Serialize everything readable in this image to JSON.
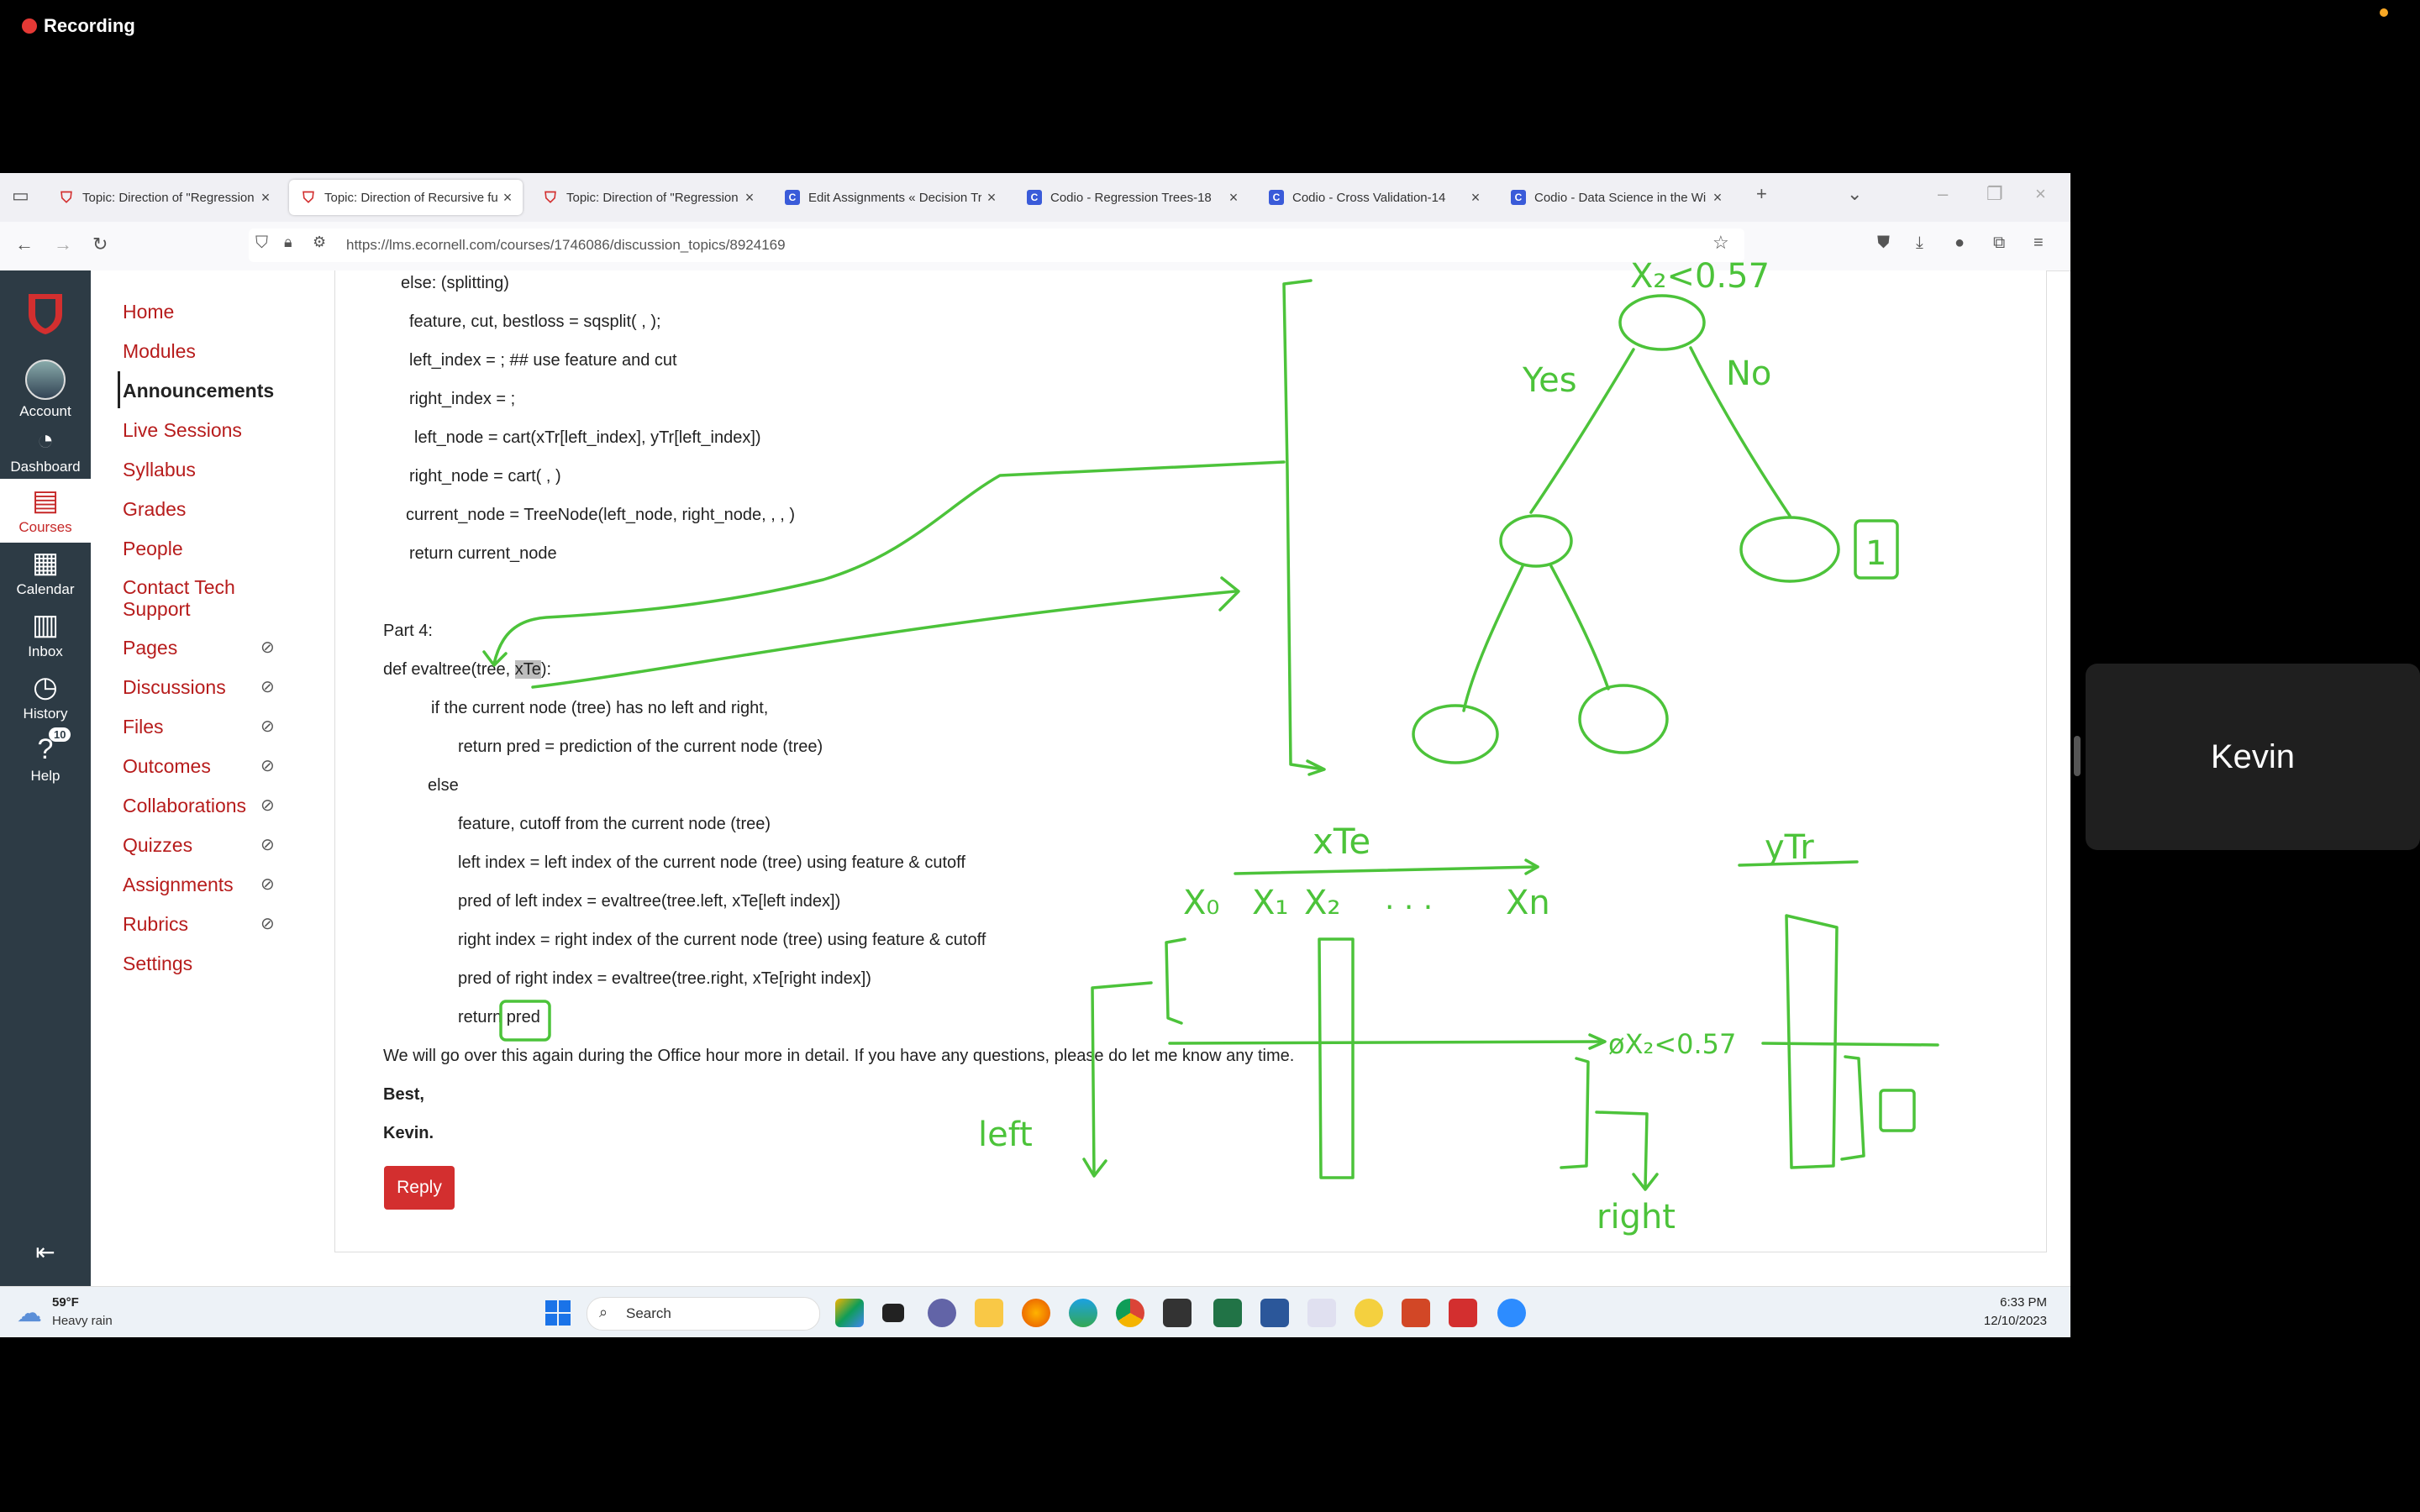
{
  "recording": {
    "label": "Recording"
  },
  "browser": {
    "tabs": [
      {
        "label": "Topic: Direction of \"Regression",
        "icon": "canvas",
        "active": false
      },
      {
        "label": "Topic: Direction of Recursive fu",
        "icon": "canvas",
        "active": true
      },
      {
        "label": "Topic: Direction of \"Regression",
        "icon": "canvas",
        "active": false
      },
      {
        "label": "Edit Assignments « Decision Tr",
        "icon": "codio",
        "active": false
      },
      {
        "label": "Codio - Regression Trees-18",
        "icon": "codio",
        "active": false
      },
      {
        "label": "Codio - Cross Validation-14",
        "icon": "codio",
        "active": false
      },
      {
        "label": "Codio - Data Science in the Wi",
        "icon": "codio",
        "active": false
      }
    ],
    "url": "https://lms.ecornell.com/courses/1746086/discussion_topics/8924169"
  },
  "global_nav": {
    "items": [
      {
        "label": "Account",
        "icon": "avatar-icon"
      },
      {
        "label": "Dashboard",
        "icon": "dashboard-icon"
      },
      {
        "label": "Courses",
        "icon": "courses-icon",
        "active": true
      },
      {
        "label": "Calendar",
        "icon": "calendar-icon"
      },
      {
        "label": "Inbox",
        "icon": "inbox-icon"
      },
      {
        "label": "History",
        "icon": "history-icon"
      },
      {
        "label": "Help",
        "icon": "help-icon",
        "badge": "10"
      }
    ],
    "collapse_icon": "collapse-icon"
  },
  "course_nav": {
    "items": [
      {
        "label": "Home"
      },
      {
        "label": "Modules"
      },
      {
        "label": "Announcements",
        "active": true
      },
      {
        "label": "Live Sessions"
      },
      {
        "label": "Syllabus"
      },
      {
        "label": "Grades"
      },
      {
        "label": "People"
      },
      {
        "label": "Contact Tech",
        "label2": "Support"
      },
      {
        "label": "Pages",
        "hidden": true
      },
      {
        "label": "Discussions",
        "hidden": true
      },
      {
        "label": "Files",
        "hidden": true
      },
      {
        "label": "Outcomes",
        "hidden": true
      },
      {
        "label": "Collaborations",
        "hidden": true
      },
      {
        "label": "Quizzes",
        "hidden": true
      },
      {
        "label": "Assignments",
        "hidden": true
      },
      {
        "label": "Rubrics",
        "hidden": true
      },
      {
        "label": "Settings"
      }
    ]
  },
  "post": {
    "lines": [
      "else: (splitting)",
      "feature, cut, bestloss = sqsplit(  , );",
      "left_index = ; ## use feature and cut",
      "right_index = ;",
      "left_node = cart(xTr[left_index], yTr[left_index])",
      "right_node = cart( , )",
      "current_node = TreeNode(left_node, right_node, , , )",
      "return current_node",
      "Part 4:",
      "def evaltree(tree, ",
      "xTe",
      "):",
      "if the current node (tree) has no left and right,",
      "return pred = prediction of the current node (tree)",
      "else",
      "feature, cutoff from the current node (tree)",
      "left index = left index of the current node (tree) using feature & cutoff",
      "pred of left index = evaltree(tree.left, xTe[left index])",
      "right index = right index of the current node (tree) using feature & cutoff",
      "pred of right index = evaltree(tree.right, xTe[right index])",
      "return pred",
      "We will go over this again during the Office hour more in detail.  If you have any questions, please do let me know any time.",
      "Best,",
      "Kevin."
    ],
    "reply_label": "Reply"
  },
  "annotations": {
    "split": "X₂<0.57",
    "yes": "Yes",
    "no": "No",
    "leaf": "1",
    "xte": "xTe",
    "ytr": "yTr",
    "x0": "X₀",
    "x1": "X₁",
    "x2": "X₂",
    "dots": ". . .",
    "xn": "Xn",
    "cond": "øX₂<0.57",
    "left": "left",
    "right": "right",
    "ink_color": "#4cc33a"
  },
  "taskbar": {
    "weather_temp": "59°F",
    "weather_desc": "Heavy rain",
    "search_placeholder": "Search",
    "time": "6:33 PM",
    "date": "12/10/2023"
  },
  "participant": {
    "name": "Kevin"
  }
}
